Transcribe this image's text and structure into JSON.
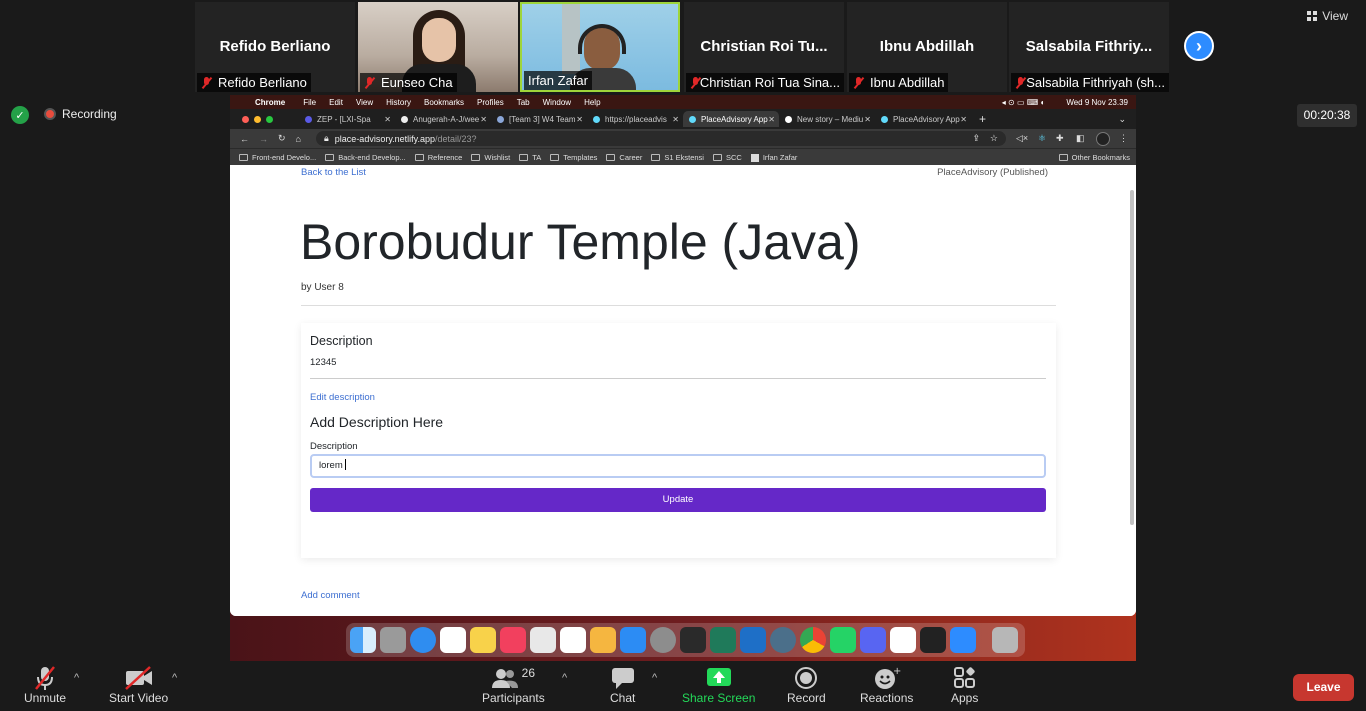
{
  "participants": [
    {
      "big_name": "Refido Berliano",
      "label": "Refido Berliano"
    },
    {
      "big_name": "",
      "label": "Eunseo Cha"
    },
    {
      "big_name": "",
      "label": "Irfan Zafar"
    },
    {
      "big_name": "Christian  Roi  Tu...",
      "label": "Christian Roi Tua Sina..."
    },
    {
      "big_name": "Ibnu Abdillah",
      "label": "Ibnu Abdillah"
    },
    {
      "big_name": "Salsabila  Fithriy...",
      "label": "Salsabila Fithriyah (sh..."
    }
  ],
  "view_label": "View",
  "recording_label": "Recording",
  "timer": "00:20:38",
  "mac_menubar": {
    "app": "Chrome",
    "items": [
      "File",
      "Edit",
      "View",
      "History",
      "Bookmarks",
      "Profiles",
      "Tab",
      "Window",
      "Help"
    ],
    "datetime": "Wed 9 Nov  23.39"
  },
  "browser": {
    "tabs": [
      {
        "title": "ZEP - [LXI-Spa"
      },
      {
        "title": "Anugerah-A-J/wee"
      },
      {
        "title": "[Team 3] W4 Team"
      },
      {
        "title": "https://placeadvis"
      },
      {
        "title": "PlaceAdvisory App"
      },
      {
        "title": "New story – Mediu"
      },
      {
        "title": "PlaceAdvisory App"
      }
    ],
    "url_host": "place-advisory.netlify.app",
    "url_path": "/detail/23?",
    "bookmarks": [
      "Front-end Develo...",
      "Back-end Develop...",
      "Reference",
      "Wishlist",
      "TA",
      "Templates",
      "Career",
      "S1 Ekstensi",
      "SCC",
      "Irfan Zafar"
    ],
    "other_bookmarks": "Other Bookmarks"
  },
  "page": {
    "back_link": "Back to the List",
    "brand": "PlaceAdvisory (Published)",
    "title": "Borobudur Temple (Java)",
    "author": "by User 8",
    "description_heading": "Description",
    "description_value": "12345",
    "edit_link": "Edit description",
    "form_heading": "Add Description Here",
    "field_label": "Description",
    "field_value": "lorem",
    "update_button": "Update",
    "add_comment": "Add comment"
  },
  "zoom_bar": {
    "unmute": "Unmute",
    "start_video": "Start Video",
    "participants_label": "Participants",
    "participants_count": "26",
    "chat": "Chat",
    "share_screen": "Share Screen",
    "record": "Record",
    "reactions": "Reactions",
    "apps": "Apps",
    "leave": "Leave"
  },
  "colors": {
    "update_button": "#6528c8",
    "link": "#3d6fd1",
    "share_screen": "#23d959",
    "leave": "#c7372f",
    "active_speaker": "#9fd53a"
  }
}
